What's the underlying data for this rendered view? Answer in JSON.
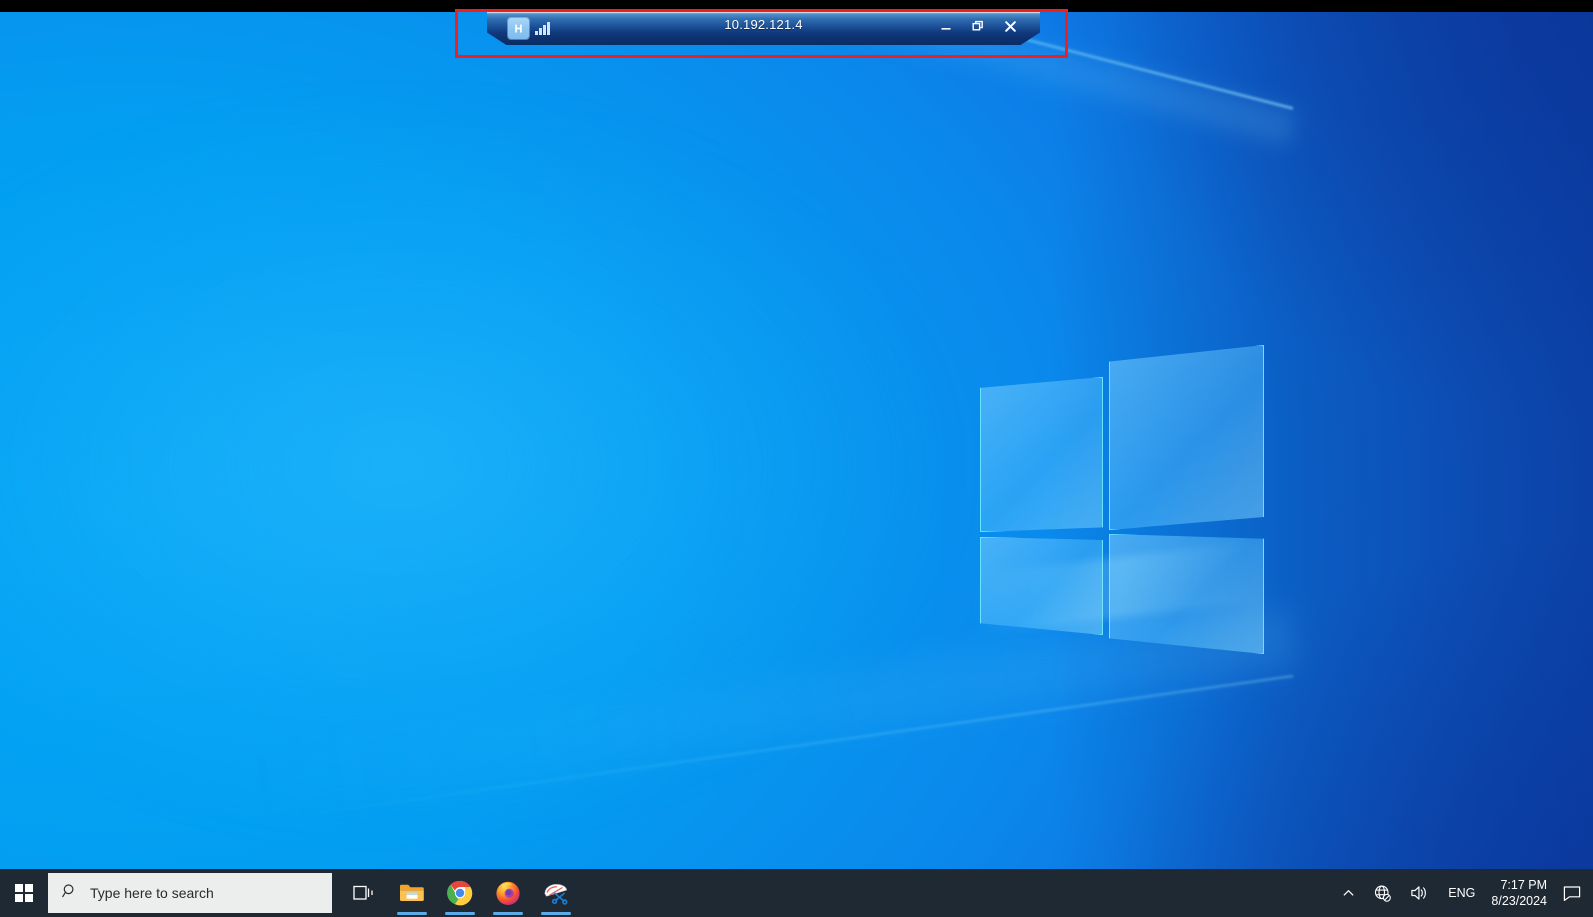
{
  "window": {
    "title": "10.192.121.4",
    "pin_icon": "pushpin-icon",
    "signal_icon": "signal-bars-icon",
    "controls": {
      "minimize_label": "Minimize",
      "restore_label": "Restore",
      "close_label": "Close"
    }
  },
  "annotation": {
    "color": "#f21d1d",
    "shape": "rectangle"
  },
  "desktop": {
    "wallpaper": "windows-10-hero-blue",
    "accent_light": "#06a7f5",
    "accent_dark": "#0f46b4"
  },
  "taskbar": {
    "background": "#1f2933",
    "start_label": "Start",
    "start_icon": "windows-logo-icon",
    "search": {
      "placeholder": "Type here to search",
      "icon": "search-icon"
    },
    "items": [
      {
        "name": "task-view",
        "label": "Task View",
        "icon": "task-view-icon",
        "running": false
      },
      {
        "name": "file-explorer",
        "label": "File Explorer",
        "icon": "folder-icon",
        "running": true
      },
      {
        "name": "google-chrome",
        "label": "Google Chrome",
        "icon": "chrome-icon",
        "running": true
      },
      {
        "name": "mozilla-firefox",
        "label": "Mozilla Firefox",
        "icon": "firefox-icon",
        "running": true
      },
      {
        "name": "snipping-tool",
        "label": "Snipping Tool",
        "icon": "scissors-icon",
        "running": true
      }
    ],
    "tray": {
      "overflow_icon": "chevron-up-icon",
      "network_icon": "globe-no-internet-icon",
      "volume_icon": "speaker-icon",
      "language": "ENG",
      "time": "7:17 PM",
      "date": "8/23/2024",
      "action_center_icon": "speech-bubble-icon"
    }
  }
}
